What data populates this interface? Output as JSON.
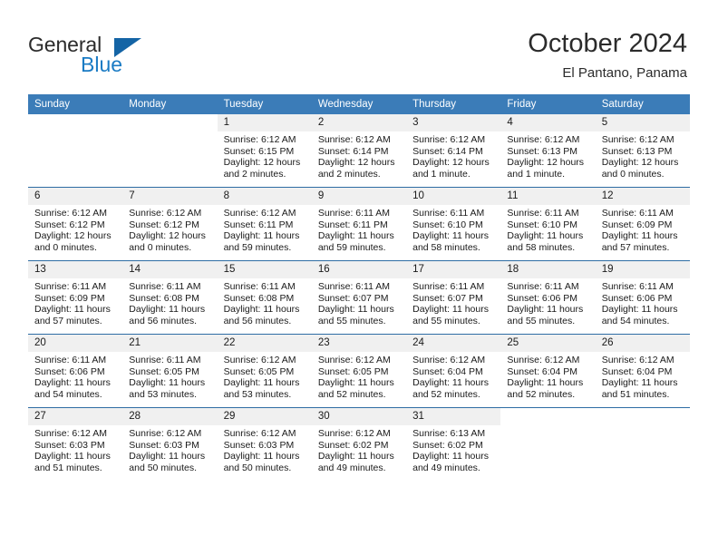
{
  "brand": {
    "name_part1": "General",
    "name_part2": "Blue"
  },
  "header": {
    "month_title": "October 2024",
    "location": "El Pantano, Panama"
  },
  "colors": {
    "header_blue": "#3b7cb8",
    "separator_blue": "#2e6da4",
    "daynum_band": "#f0f0f0",
    "logo_blue": "#1a7bc4",
    "logo_triangle": "#1464a5",
    "text": "#1a1a1a"
  },
  "weekday_headers": [
    "Sunday",
    "Monday",
    "Tuesday",
    "Wednesday",
    "Thursday",
    "Friday",
    "Saturday"
  ],
  "calendar_data": {
    "month": "October",
    "year": 2024,
    "location": "El Pantano, Panama",
    "first_day_of_week": "Sunday",
    "weeks": [
      [
        {
          "day": "",
          "blank": true,
          "sunrise": "",
          "sunset": "",
          "daylight_line1": "",
          "daylight_line2": ""
        },
        {
          "day": "",
          "blank": true,
          "sunrise": "",
          "sunset": "",
          "daylight_line1": "",
          "daylight_line2": ""
        },
        {
          "day": "1",
          "blank": false,
          "sunrise": "Sunrise: 6:12 AM",
          "sunset": "Sunset: 6:15 PM",
          "daylight_line1": "Daylight: 12 hours",
          "daylight_line2": "and 2 minutes."
        },
        {
          "day": "2",
          "blank": false,
          "sunrise": "Sunrise: 6:12 AM",
          "sunset": "Sunset: 6:14 PM",
          "daylight_line1": "Daylight: 12 hours",
          "daylight_line2": "and 2 minutes."
        },
        {
          "day": "3",
          "blank": false,
          "sunrise": "Sunrise: 6:12 AM",
          "sunset": "Sunset: 6:14 PM",
          "daylight_line1": "Daylight: 12 hours",
          "daylight_line2": "and 1 minute."
        },
        {
          "day": "4",
          "blank": false,
          "sunrise": "Sunrise: 6:12 AM",
          "sunset": "Sunset: 6:13 PM",
          "daylight_line1": "Daylight: 12 hours",
          "daylight_line2": "and 1 minute."
        },
        {
          "day": "5",
          "blank": false,
          "sunrise": "Sunrise: 6:12 AM",
          "sunset": "Sunset: 6:13 PM",
          "daylight_line1": "Daylight: 12 hours",
          "daylight_line2": "and 0 minutes."
        }
      ],
      [
        {
          "day": "6",
          "blank": false,
          "sunrise": "Sunrise: 6:12 AM",
          "sunset": "Sunset: 6:12 PM",
          "daylight_line1": "Daylight: 12 hours",
          "daylight_line2": "and 0 minutes."
        },
        {
          "day": "7",
          "blank": false,
          "sunrise": "Sunrise: 6:12 AM",
          "sunset": "Sunset: 6:12 PM",
          "daylight_line1": "Daylight: 12 hours",
          "daylight_line2": "and 0 minutes."
        },
        {
          "day": "8",
          "blank": false,
          "sunrise": "Sunrise: 6:12 AM",
          "sunset": "Sunset: 6:11 PM",
          "daylight_line1": "Daylight: 11 hours",
          "daylight_line2": "and 59 minutes."
        },
        {
          "day": "9",
          "blank": false,
          "sunrise": "Sunrise: 6:11 AM",
          "sunset": "Sunset: 6:11 PM",
          "daylight_line1": "Daylight: 11 hours",
          "daylight_line2": "and 59 minutes."
        },
        {
          "day": "10",
          "blank": false,
          "sunrise": "Sunrise: 6:11 AM",
          "sunset": "Sunset: 6:10 PM",
          "daylight_line1": "Daylight: 11 hours",
          "daylight_line2": "and 58 minutes."
        },
        {
          "day": "11",
          "blank": false,
          "sunrise": "Sunrise: 6:11 AM",
          "sunset": "Sunset: 6:10 PM",
          "daylight_line1": "Daylight: 11 hours",
          "daylight_line2": "and 58 minutes."
        },
        {
          "day": "12",
          "blank": false,
          "sunrise": "Sunrise: 6:11 AM",
          "sunset": "Sunset: 6:09 PM",
          "daylight_line1": "Daylight: 11 hours",
          "daylight_line2": "and 57 minutes."
        }
      ],
      [
        {
          "day": "13",
          "blank": false,
          "sunrise": "Sunrise: 6:11 AM",
          "sunset": "Sunset: 6:09 PM",
          "daylight_line1": "Daylight: 11 hours",
          "daylight_line2": "and 57 minutes."
        },
        {
          "day": "14",
          "blank": false,
          "sunrise": "Sunrise: 6:11 AM",
          "sunset": "Sunset: 6:08 PM",
          "daylight_line1": "Daylight: 11 hours",
          "daylight_line2": "and 56 minutes."
        },
        {
          "day": "15",
          "blank": false,
          "sunrise": "Sunrise: 6:11 AM",
          "sunset": "Sunset: 6:08 PM",
          "daylight_line1": "Daylight: 11 hours",
          "daylight_line2": "and 56 minutes."
        },
        {
          "day": "16",
          "blank": false,
          "sunrise": "Sunrise: 6:11 AM",
          "sunset": "Sunset: 6:07 PM",
          "daylight_line1": "Daylight: 11 hours",
          "daylight_line2": "and 55 minutes."
        },
        {
          "day": "17",
          "blank": false,
          "sunrise": "Sunrise: 6:11 AM",
          "sunset": "Sunset: 6:07 PM",
          "daylight_line1": "Daylight: 11 hours",
          "daylight_line2": "and 55 minutes."
        },
        {
          "day": "18",
          "blank": false,
          "sunrise": "Sunrise: 6:11 AM",
          "sunset": "Sunset: 6:06 PM",
          "daylight_line1": "Daylight: 11 hours",
          "daylight_line2": "and 55 minutes."
        },
        {
          "day": "19",
          "blank": false,
          "sunrise": "Sunrise: 6:11 AM",
          "sunset": "Sunset: 6:06 PM",
          "daylight_line1": "Daylight: 11 hours",
          "daylight_line2": "and 54 minutes."
        }
      ],
      [
        {
          "day": "20",
          "blank": false,
          "sunrise": "Sunrise: 6:11 AM",
          "sunset": "Sunset: 6:06 PM",
          "daylight_line1": "Daylight: 11 hours",
          "daylight_line2": "and 54 minutes."
        },
        {
          "day": "21",
          "blank": false,
          "sunrise": "Sunrise: 6:11 AM",
          "sunset": "Sunset: 6:05 PM",
          "daylight_line1": "Daylight: 11 hours",
          "daylight_line2": "and 53 minutes."
        },
        {
          "day": "22",
          "blank": false,
          "sunrise": "Sunrise: 6:12 AM",
          "sunset": "Sunset: 6:05 PM",
          "daylight_line1": "Daylight: 11 hours",
          "daylight_line2": "and 53 minutes."
        },
        {
          "day": "23",
          "blank": false,
          "sunrise": "Sunrise: 6:12 AM",
          "sunset": "Sunset: 6:05 PM",
          "daylight_line1": "Daylight: 11 hours",
          "daylight_line2": "and 52 minutes."
        },
        {
          "day": "24",
          "blank": false,
          "sunrise": "Sunrise: 6:12 AM",
          "sunset": "Sunset: 6:04 PM",
          "daylight_line1": "Daylight: 11 hours",
          "daylight_line2": "and 52 minutes."
        },
        {
          "day": "25",
          "blank": false,
          "sunrise": "Sunrise: 6:12 AM",
          "sunset": "Sunset: 6:04 PM",
          "daylight_line1": "Daylight: 11 hours",
          "daylight_line2": "and 52 minutes."
        },
        {
          "day": "26",
          "blank": false,
          "sunrise": "Sunrise: 6:12 AM",
          "sunset": "Sunset: 6:04 PM",
          "daylight_line1": "Daylight: 11 hours",
          "daylight_line2": "and 51 minutes."
        }
      ],
      [
        {
          "day": "27",
          "blank": false,
          "sunrise": "Sunrise: 6:12 AM",
          "sunset": "Sunset: 6:03 PM",
          "daylight_line1": "Daylight: 11 hours",
          "daylight_line2": "and 51 minutes."
        },
        {
          "day": "28",
          "blank": false,
          "sunrise": "Sunrise: 6:12 AM",
          "sunset": "Sunset: 6:03 PM",
          "daylight_line1": "Daylight: 11 hours",
          "daylight_line2": "and 50 minutes."
        },
        {
          "day": "29",
          "blank": false,
          "sunrise": "Sunrise: 6:12 AM",
          "sunset": "Sunset: 6:03 PM",
          "daylight_line1": "Daylight: 11 hours",
          "daylight_line2": "and 50 minutes."
        },
        {
          "day": "30",
          "blank": false,
          "sunrise": "Sunrise: 6:12 AM",
          "sunset": "Sunset: 6:02 PM",
          "daylight_line1": "Daylight: 11 hours",
          "daylight_line2": "and 49 minutes."
        },
        {
          "day": "31",
          "blank": false,
          "sunrise": "Sunrise: 6:13 AM",
          "sunset": "Sunset: 6:02 PM",
          "daylight_line1": "Daylight: 11 hours",
          "daylight_line2": "and 49 minutes."
        },
        {
          "day": "",
          "blank": true,
          "sunrise": "",
          "sunset": "",
          "daylight_line1": "",
          "daylight_line2": ""
        },
        {
          "day": "",
          "blank": true,
          "sunrise": "",
          "sunset": "",
          "daylight_line1": "",
          "daylight_line2": ""
        }
      ]
    ]
  }
}
